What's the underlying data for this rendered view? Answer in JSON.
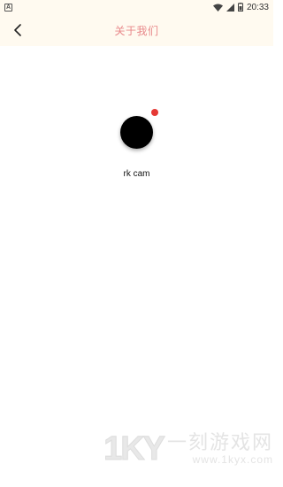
{
  "status_bar": {
    "notification_icon": "a-notification-icon",
    "time": "20:33",
    "icons": [
      "wifi-icon",
      "signal-icon",
      "battery-icon"
    ]
  },
  "app_bar": {
    "back_icon": "chevron-left-icon",
    "title": "关于我们"
  },
  "about": {
    "logo_icon": "black-circle-logo",
    "badge_color": "#e53935",
    "app_name": "rk cam"
  },
  "watermark": {
    "mark": "1KY",
    "brand": "一刻游戏网",
    "url": "www.1kyx.com"
  },
  "colors": {
    "bar_background": "#fffaf0",
    "title_color": "#e8888a",
    "logo_color": "#000000"
  }
}
